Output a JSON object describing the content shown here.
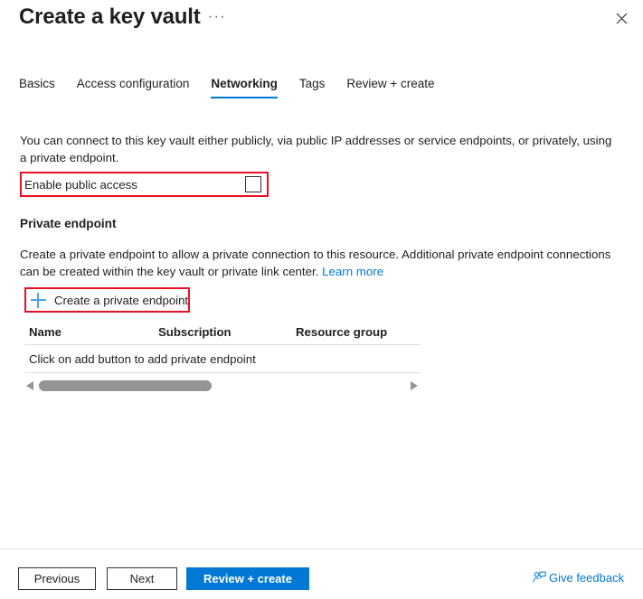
{
  "header": {
    "title": "Create a key vault",
    "ellipsis": "···",
    "close_icon": "close-icon"
  },
  "tabs": [
    {
      "label": "Basics",
      "active": false
    },
    {
      "label": "Access configuration",
      "active": false
    },
    {
      "label": "Networking",
      "active": true
    },
    {
      "label": "Tags",
      "active": false
    },
    {
      "label": "Review + create",
      "active": false
    }
  ],
  "main": {
    "intro": "You can connect to this key vault either publicly, via public IP addresses or service endpoints, or privately, using a private endpoint.",
    "public_access": {
      "label": "Enable public access",
      "checked": false
    },
    "private_endpoint": {
      "heading": "Private endpoint",
      "description": "Create a private endpoint to allow a private connection to this resource. Additional private endpoint connections can be created within the key vault or private link center.",
      "learn_more": "Learn more",
      "create_button": "Create a private endpoint",
      "table": {
        "columns": [
          "Name",
          "Subscription",
          "Resource group"
        ],
        "empty_message": "Click on add button to add private endpoint"
      }
    }
  },
  "footer": {
    "previous": "Previous",
    "next": "Next",
    "review_create": "Review + create",
    "feedback": "Give feedback"
  },
  "colors": {
    "accent": "#0078d4",
    "annotation": "#e81123",
    "plus": "#4aa7e0",
    "text": "#201f1e",
    "border": "#e1dfdd"
  }
}
